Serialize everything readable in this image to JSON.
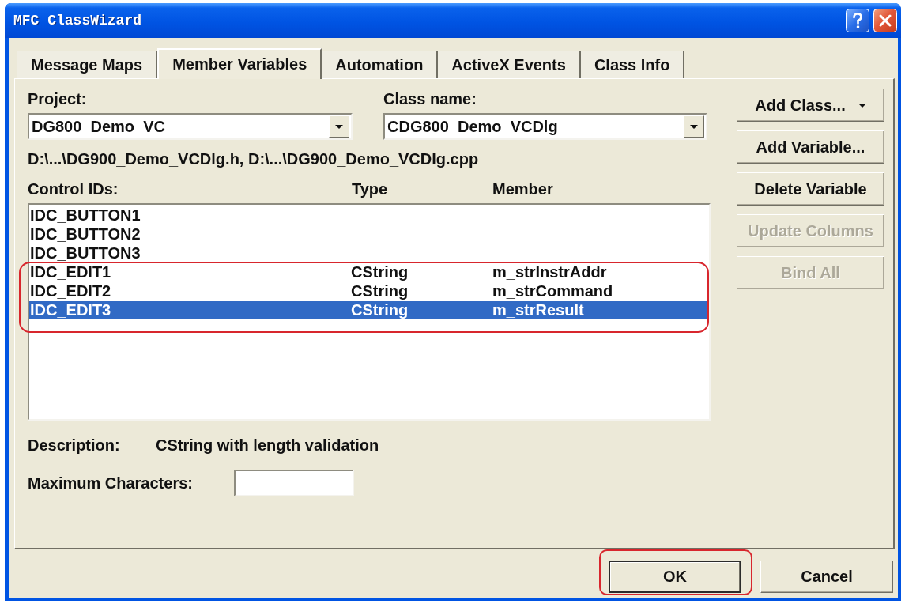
{
  "window": {
    "title": "MFC ClassWizard"
  },
  "tabs": [
    {
      "label": "Message Maps",
      "selected": false
    },
    {
      "label": "Member Variables",
      "selected": true
    },
    {
      "label": "Automation",
      "selected": false
    },
    {
      "label": "ActiveX Events",
      "selected": false
    },
    {
      "label": "Class Info",
      "selected": false
    }
  ],
  "project": {
    "label": "Project:",
    "value": "DG800_Demo_VC"
  },
  "class_name": {
    "label": "Class name:",
    "value": "CDG800_Demo_VCDlg"
  },
  "file_paths": "D:\\...\\DG900_Demo_VCDlg.h, D:\\...\\DG900_Demo_VCDlg.cpp",
  "list": {
    "columns": [
      {
        "label": "Control IDs:"
      },
      {
        "label": "Type"
      },
      {
        "label": "Member"
      }
    ],
    "rows": [
      {
        "control_id": "IDC_BUTTON1",
        "selected": false,
        "highlighted": false
      },
      {
        "control_id": "IDC_BUTTON2",
        "selected": false,
        "highlighted": false
      },
      {
        "control_id": "IDC_BUTTON3",
        "selected": false,
        "highlighted": false
      },
      {
        "control_id": "IDC_EDIT1",
        "type": "CString",
        "member": "m_strInstrAddr",
        "selected": false,
        "highlighted": true
      },
      {
        "control_id": "IDC_EDIT2",
        "type": "CString",
        "member": "m_strCommand",
        "selected": false,
        "highlighted": true
      },
      {
        "control_id": "IDC_EDIT3",
        "type": "CString",
        "member": "m_strResult",
        "selected": true,
        "highlighted": true
      }
    ]
  },
  "description": {
    "label": "Description:",
    "value": "CString with length validation"
  },
  "maximum_characters": {
    "label": "Maximum Characters:"
  },
  "side_buttons": [
    {
      "label": "Add Class...",
      "kind": "menu",
      "disabled": false
    },
    {
      "label": "Add Variable...",
      "kind": "push",
      "disabled": false
    },
    {
      "label": "Delete Variable",
      "kind": "push",
      "disabled": false
    },
    {
      "label": "Update Columns",
      "kind": "push",
      "disabled": true
    },
    {
      "label": "Bind All",
      "kind": "push",
      "disabled": true
    }
  ],
  "dialog_buttons": [
    {
      "label": "OK",
      "default": true,
      "highlighted": true
    },
    {
      "label": "Cancel",
      "default": false,
      "highlighted": false
    }
  ]
}
